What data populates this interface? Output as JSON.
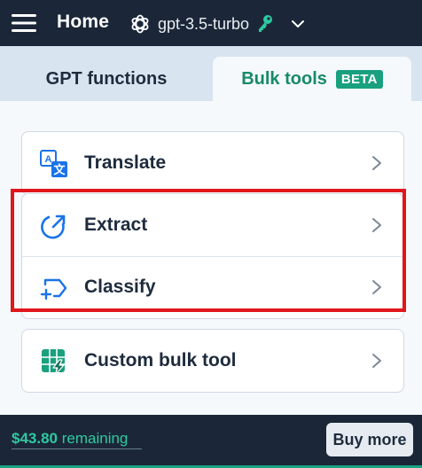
{
  "header": {
    "title": "Home",
    "model": "gpt-3.5-turbo",
    "icons": {
      "menu": "hamburger-menu-icon",
      "model": "openai-logo-icon",
      "key": "key-icon",
      "dropdown": "chevron-down-icon"
    }
  },
  "tabs": [
    {
      "label": "GPT functions",
      "active": false
    },
    {
      "label": "Bulk tools",
      "badge": "BETA",
      "active": true
    }
  ],
  "tools": [
    {
      "label": "Translate",
      "icon": "translate-icon"
    },
    {
      "label": "Extract",
      "icon": "extract-icon"
    },
    {
      "label": "Classify",
      "icon": "classify-icon"
    },
    {
      "label": "Custom bulk tool",
      "icon": "custom-bulk-tool-icon"
    }
  ],
  "footer": {
    "amount": "$43.80",
    "remaining_label": "remaining",
    "buy_label": "Buy more"
  },
  "colors": {
    "header_bg": "#1b2738",
    "accent_green": "#168a6a",
    "icon_blue": "#1a73e8",
    "highlight_red": "#e0161b"
  }
}
